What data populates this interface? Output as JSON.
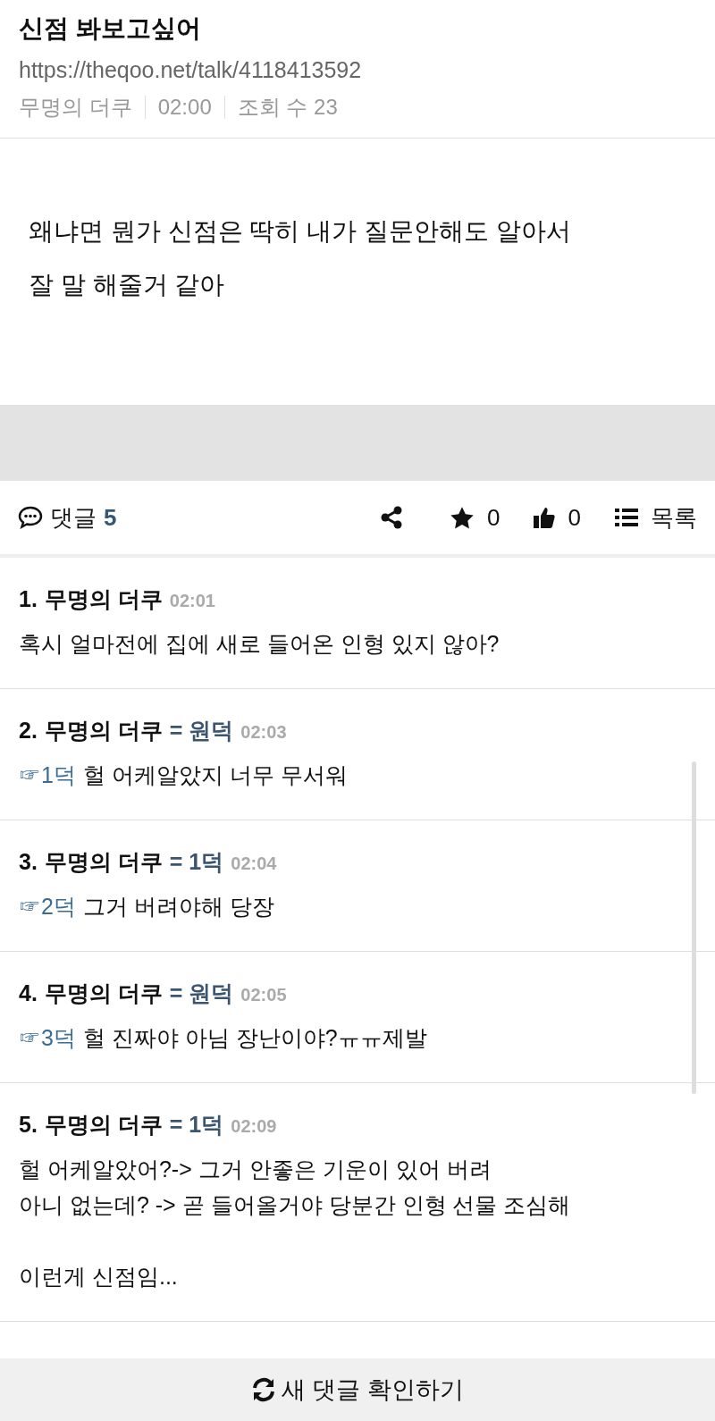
{
  "post": {
    "title": "신점 봐보고싶어",
    "url": "https://theqoo.net/talk/4118413592",
    "author": "무명의 더쿠",
    "time": "02:00",
    "views": "조회 수 23",
    "body": [
      "왜냐면 뭔가 신점은 딱히 내가 질문안해도 알아서",
      "잘 말 해줄거 같아"
    ]
  },
  "toolbar": {
    "comments_label": "댓글",
    "comments_count": "5",
    "stars": "0",
    "likes": "0",
    "list_label": "목록"
  },
  "comments": [
    {
      "number": "1.",
      "author": "무명의 더쿠",
      "time": "02:01",
      "paragraphs": [
        "혹시 얼마전에 집에 새로 들어온 인형 있지 않아?"
      ]
    },
    {
      "number": "2.",
      "author": "무명의 더쿠",
      "tag": "= 원덕",
      "time": "02:03",
      "reply_to": "☞1덕",
      "paragraphs": [
        "헐 어케알았지 너무 무서워"
      ]
    },
    {
      "number": "3.",
      "author": "무명의 더쿠",
      "tag": "= 1덕",
      "time": "02:04",
      "reply_to": "☞2덕",
      "paragraphs": [
        "그거 버려야해 당장"
      ]
    },
    {
      "number": "4.",
      "author": "무명의 더쿠",
      "tag": "= 원덕",
      "time": "02:05",
      "reply_to": "☞3덕",
      "paragraphs": [
        "헐 진짜야 아님 장난이야?ㅠㅠ제발"
      ]
    },
    {
      "number": "5.",
      "author": "무명의 더쿠",
      "tag": "= 1덕",
      "time": "02:09",
      "paragraphs": [
        "헐 어케알았어?-> 그거 안좋은 기운이 있어 버려\n아니 없는데? -> 곧 들어올거야 당분간 인형 선물 조심해",
        "이런게 신점임..."
      ]
    }
  ],
  "refresh_button": "새 댓글 확인하기"
}
